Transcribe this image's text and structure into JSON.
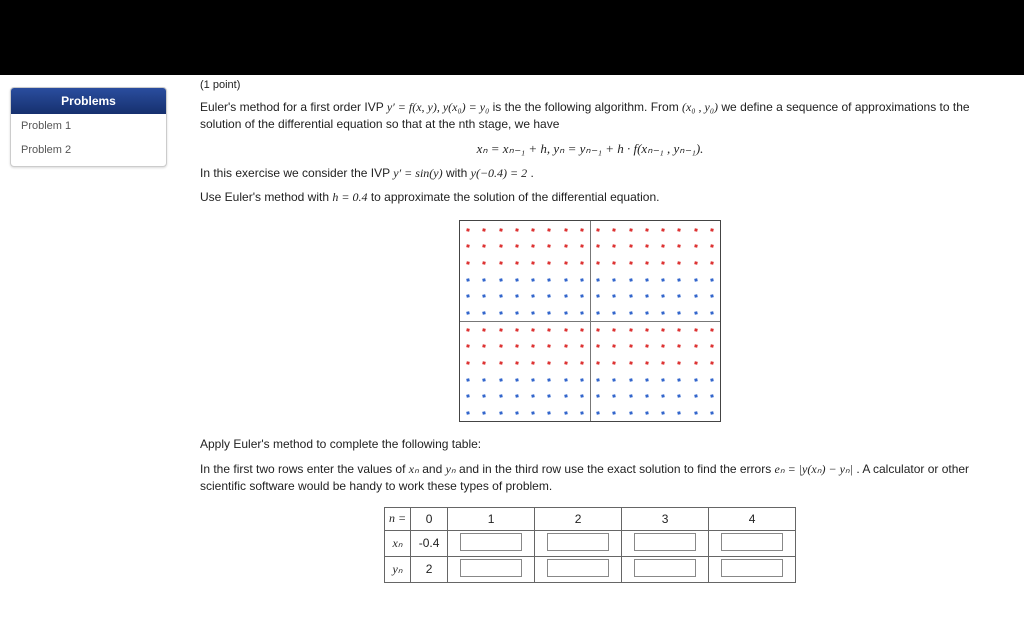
{
  "sidebar": {
    "header": "Problems",
    "items": [
      "Problem 1",
      "Problem 2"
    ]
  },
  "header_points": "(1 point)",
  "intro_1": "Euler's method for a first order IVP ",
  "intro_ivp": "y′ = f(x, y),  y(x₀) = y₀",
  "intro_2": " is the the following algorithm. From ",
  "intro_from": "(x₀ , y₀)",
  "intro_3": " we define a sequence of approximations to the solution of the differential equation so that at the nth stage, we have",
  "formula": "xₙ = xₙ₋₁ + h,   yₙ = yₙ₋₁ + h · f(xₙ₋₁ , yₙ₋₁).",
  "exercise_1": "In this exercise we consider the IVP ",
  "exercise_ivp": "y′ = sin(y)",
  "exercise_2": " with ",
  "exercise_cond": "y(−0.4) = 2",
  "exercise_3": ".",
  "use_1": "Use Euler's method with ",
  "use_h": "h = 0.4",
  "use_2": " to approximate the solution of the differential equation.",
  "apply": "Apply Euler's method to complete the following table:",
  "rows_1": "In the first two rows enter the values of ",
  "rows_xn": "xₙ",
  "rows_2": " and ",
  "rows_yn": "yₙ",
  "rows_3": " and in the third row use the exact solution to find the errors ",
  "rows_en": "eₙ = |y(xₙ) − yₙ|",
  "rows_4": ". A calculator or other scientific software would be handy to work these types of problem.",
  "table": {
    "row_n_label": "n =",
    "row_xn_label": "xₙ",
    "row_yn_label": "yₙ",
    "n_values": [
      "0",
      "1",
      "2",
      "3",
      "4"
    ],
    "xn_first": "-0.4",
    "yn_first": "2"
  }
}
